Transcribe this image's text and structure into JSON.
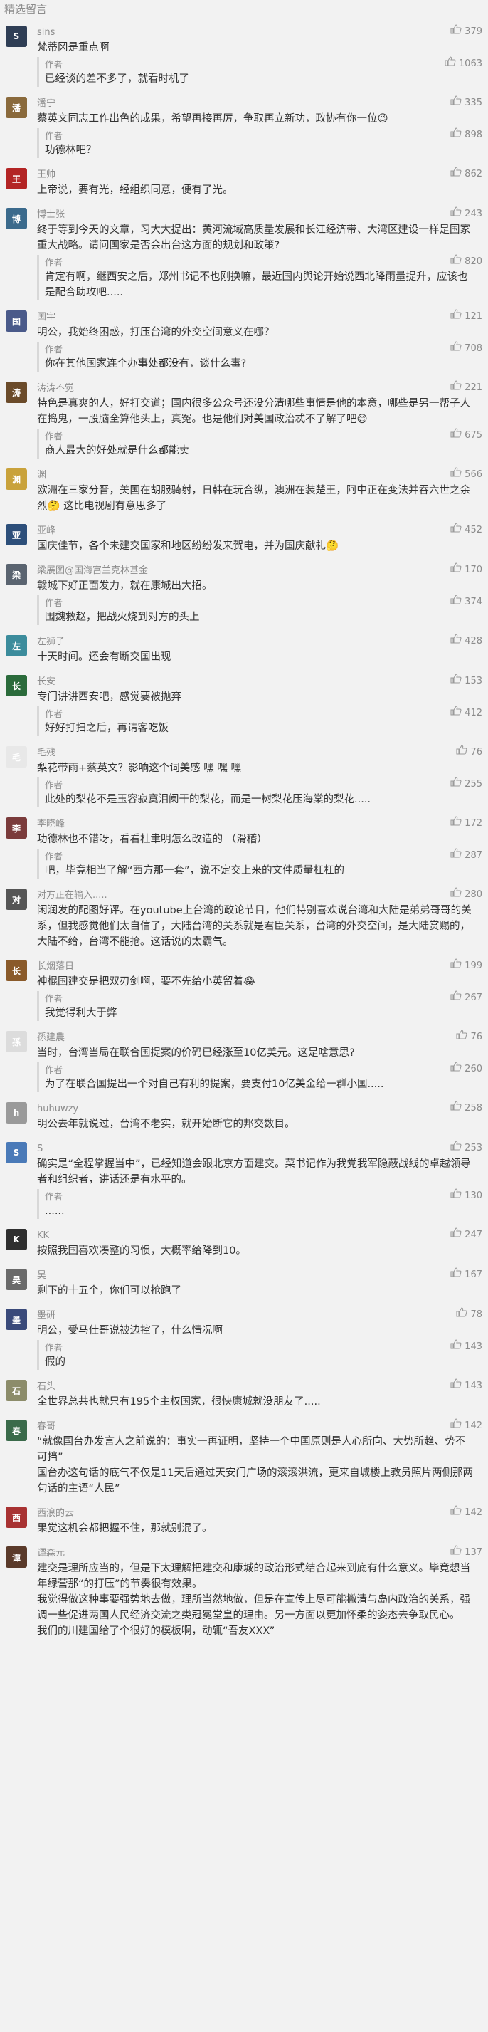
{
  "section_title": "精选留言",
  "comments": [
    {
      "nick": "sins",
      "avatar_color": "#2f3e55",
      "avatar_char": "S",
      "likes": "379",
      "text": "梵蒂冈是重点啊",
      "reply": {
        "label": "作者",
        "likes": "1063",
        "text": "已经谈的差不多了，就看时机了"
      }
    },
    {
      "nick": "潘宁",
      "avatar_color": "#8a6a3c",
      "avatar_char": "潘",
      "likes": "335",
      "text": "蔡英文同志工作出色的成果，希望再接再厉，争取再立新功，政协有你一位😉",
      "reply": {
        "label": "作者",
        "likes": "898",
        "text": "功德林吧？"
      }
    },
    {
      "nick": "王帅",
      "avatar_color": "#b32424",
      "avatar_char": "王",
      "likes": "862",
      "text": "上帝说，要有光，经组织同意，便有了光。",
      "reply": null
    },
    {
      "nick": "博士张",
      "avatar_color": "#3b6a8c",
      "avatar_char": "博",
      "likes": "243",
      "text": "终于等到今天的文章，习大大提出：黄河流域高质量发展和长江经济带、大湾区建设一样是国家重大战略。请问国家是否会出台这方面的规划和政策?",
      "reply": {
        "label": "作者",
        "likes": "820",
        "text": "肯定有啊，继西安之后，郑州书记不也刚换嘛，最近国内舆论开始说西北降雨量提升，应该也是配合助攻吧....."
      }
    },
    {
      "nick": "国宇",
      "avatar_color": "#4a5a8a",
      "avatar_char": "国",
      "likes": "121",
      "text": "明公，我始终困惑，打压台湾的外交空间意义在哪？",
      "reply": {
        "label": "作者",
        "likes": "708",
        "text": "你在其他国家连个办事处都没有，谈什么毒?"
      }
    },
    {
      "nick": "涛涛不觉",
      "avatar_color": "#6b4b2a",
      "avatar_char": "涛",
      "likes": "221",
      "text": "特色是真爽的人，好打交道；国内很多公众号还没分清哪些事情是他的本意，哪些是另一帮子人在捣鬼，一股脑全算他头上，真冤。也是他们对美国政治忒不了解了吧😊",
      "reply": {
        "label": "作者",
        "likes": "675",
        "text": "商人最大的好处就是什么都能卖"
      }
    },
    {
      "nick": "渊",
      "avatar_color": "#c9a23b",
      "avatar_char": "渊",
      "likes": "566",
      "text": "欧洲在三家分晋，美国在胡服骑射，日韩在玩合纵，澳洲在装楚王，阿中正在变法并吞六世之余烈🤔 这比电视剧有意思多了",
      "reply": null
    },
    {
      "nick": "亚峰",
      "avatar_color": "#2d4f7a",
      "avatar_char": "亚",
      "likes": "452",
      "text": "国庆佳节，各个未建交国家和地区纷纷发来贺电，并为国庆献礼🤔",
      "reply": null
    },
    {
      "nick": "梁展图@国海富兰克林基金",
      "avatar_color": "#5a6470",
      "avatar_char": "梁",
      "likes": "170",
      "text": "赣城下好正面发力，就在康城出大招。",
      "reply": {
        "label": "作者",
        "likes": "374",
        "text": "围魏救赵，把战火烧到对方的头上"
      }
    },
    {
      "nick": "左狮子",
      "avatar_color": "#3c8c9c",
      "avatar_char": "左",
      "likes": "428",
      "text": "十天时间。还会有断交国出现",
      "reply": null
    },
    {
      "nick": "长安",
      "avatar_color": "#2b6b3b",
      "avatar_char": "长",
      "likes": "153",
      "text": "专门讲讲西安吧，感觉要被抛弃",
      "reply": {
        "label": "作者",
        "likes": "412",
        "text": "好好打扫之后，再请客吃饭"
      }
    },
    {
      "nick": "毛残",
      "avatar_color": "#e8e8e8",
      "avatar_char": "毛",
      "likes": "76",
      "text": "梨花带雨+蔡英文？影响这个词美感 嘿 嘿 嘿",
      "reply": {
        "label": "作者",
        "likes": "255",
        "text": "此处的梨花不是玉容寂寞泪阑干的梨花，而是一树梨花压海棠的梨花....."
      }
    },
    {
      "nick": "李晓峰",
      "avatar_color": "#7a3b3b",
      "avatar_char": "李",
      "likes": "172",
      "text": "功德林也不错呀，看看杜聿明怎么改造的 （滑稽）",
      "reply": {
        "label": "作者",
        "likes": "287",
        "text": "吧，毕竟相当了解“西方那一套”，说不定交上来的文件质量杠杠的"
      }
    },
    {
      "nick": "对方正在输入.....",
      "avatar_color": "#555555",
      "avatar_char": "对",
      "likes": "280",
      "text": "闲润发的配图好评。在youtube上台湾的政论节目，他们特别喜欢说台湾和大陆是弟弟哥哥的关系，但我感觉他们太自信了，大陆台湾的关系就是君臣关系，台湾的外交空间，是大陆赏赐的，大陆不给，台湾不能抢。这话说的太霸气。",
      "reply": null
    },
    {
      "nick": "长烟落日",
      "avatar_color": "#8a5a2a",
      "avatar_char": "长",
      "likes": "199",
      "text": "神棍国建交是把双刃剑啊，要不先给小英留着😂",
      "reply": {
        "label": "作者",
        "likes": "267",
        "text": "我觉得利大于弊"
      }
    },
    {
      "nick": "孫建農",
      "avatar_color": "#dcdcdc",
      "avatar_char": "孫",
      "likes": "76",
      "text": "当时，台湾当局在联合国提案的价码已经涨至10亿美元。这是啥意思?",
      "reply": {
        "label": "作者",
        "likes": "260",
        "text": "为了在联合国提出一个对自己有利的提案，要支付10亿美金给一群小国....."
      }
    },
    {
      "nick": "huhuwzy",
      "avatar_color": "#9a9a9a",
      "avatar_char": "h",
      "likes": "258",
      "text": "明公去年就说过，台湾不老实，就开始断它的邦交数目。",
      "reply": null
    },
    {
      "nick": "S",
      "avatar_color": "#4a7ab8",
      "avatar_char": "S",
      "likes": "253",
      "text": "确实是“全程掌握当中”，已经知道会跟北京方面建交。菜书记作为我党我军隐蔽战线的卓越领导者和组织者，讲话还是有水平的。",
      "reply": {
        "label": "作者",
        "likes": "130",
        "text": "......"
      }
    },
    {
      "nick": "KK",
      "avatar_color": "#2f2f2f",
      "avatar_char": "K",
      "likes": "247",
      "text": "按照我国喜欢凑整的习惯，大概率给降到10。",
      "reply": null
    },
    {
      "nick": "昊",
      "avatar_color": "#6a6a6a",
      "avatar_char": "昊",
      "likes": "167",
      "text": "剩下的十五个，你们可以抢跑了",
      "reply": null
    },
    {
      "nick": "墨研",
      "avatar_color": "#3a4a7a",
      "avatar_char": "墨",
      "likes": "78",
      "text": "明公，受马仕哥说被边控了，什么情况啊",
      "reply": {
        "label": "作者",
        "likes": "143",
        "text": "假的"
      }
    },
    {
      "nick": "石头",
      "avatar_color": "#8c8c6a",
      "avatar_char": "石",
      "likes": "143",
      "text": "全世界总共也就只有195个主权国家，很快康城就没朋友了.....",
      "reply": null
    },
    {
      "nick": "春哥",
      "avatar_color": "#3a6a4a",
      "avatar_char": "春",
      "likes": "142",
      "text": "“就像国台办发言人之前说的：事实一再证明，坚持一个中国原则是人心所向、大势所趋、势不可挡”\n国台办这句话的底气不仅是11天后通过天安门广场的滚滚洪流，更来自城楼上教员照片两侧那两句话的主语“人民”",
      "reply": null
    },
    {
      "nick": "西浪的云",
      "avatar_color": "#a83232",
      "avatar_char": "西",
      "likes": "142",
      "text": "果觉这机会都把握不住，那就别混了。",
      "reply": null
    },
    {
      "nick": "谭森元",
      "avatar_color": "#5a3a2a",
      "avatar_char": "谭",
      "likes": "137",
      "text": "建交是理所应当的，但是下太理解把建交和康城的政治形式结合起来到底有什么意义。毕竟想当年绿营那“的打压”的节奏很有效果。\n我觉得做这种事要强势地去做，理所当然地做，但是在宣传上尽可能撇清与岛内政治的关系，强调一些促进两国人民经济交流之类冠冕堂皇的理由。另一方面以更加怀柔的姿态去争取民心。\n我们的川建国给了个很好的模板啊，动辄“吾友XXX”",
      "reply": null
    }
  ]
}
